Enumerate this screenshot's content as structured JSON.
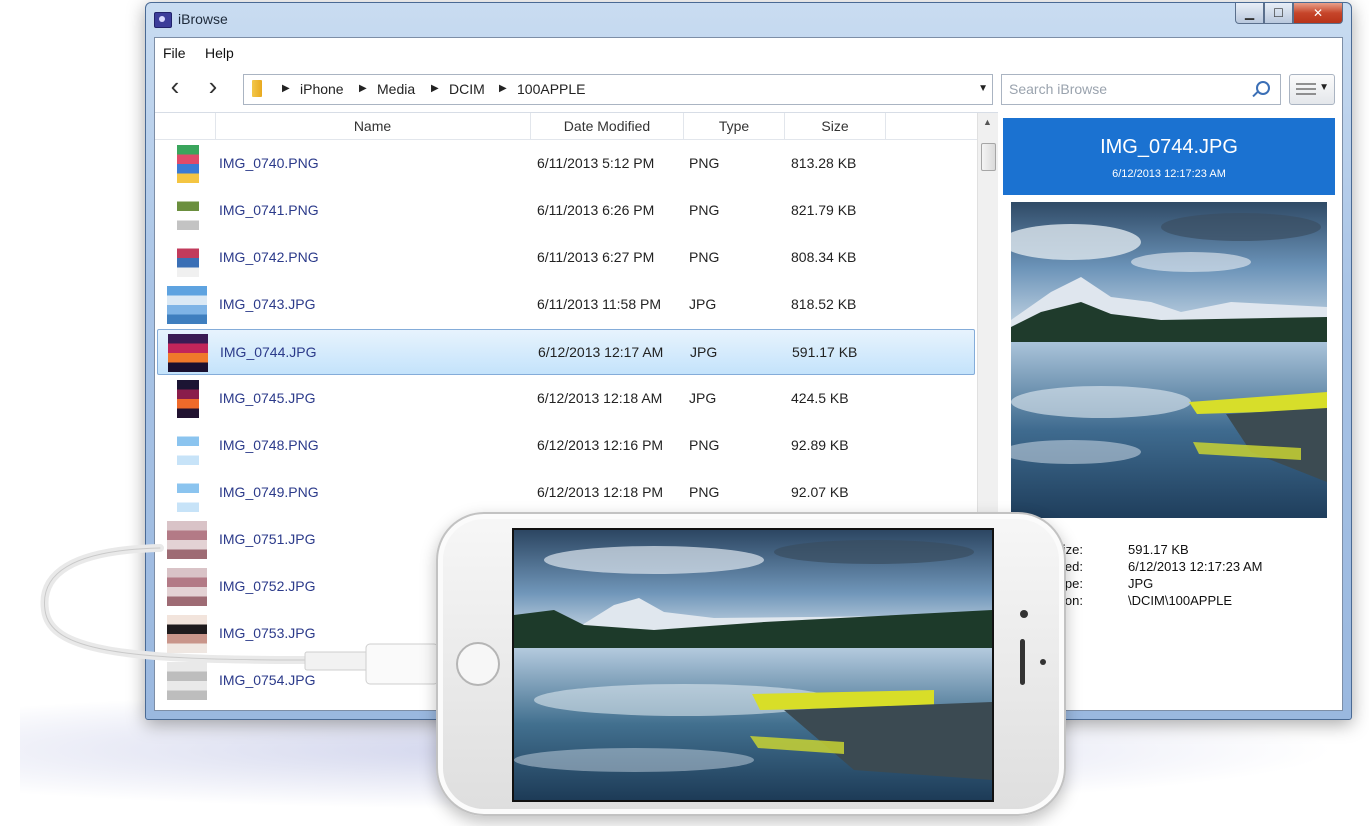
{
  "window": {
    "title": "iBrowse"
  },
  "menu": [
    "File",
    "Help"
  ],
  "breadcrumbs": [
    "iPhone",
    "Media",
    "DCIM",
    "100APPLE"
  ],
  "search": {
    "placeholder": "Search iBrowse"
  },
  "columns": {
    "name": "Name",
    "date": "Date Modified",
    "type": "Type",
    "size": "Size"
  },
  "files": [
    {
      "name": "IMG_0740.PNG",
      "date": "6/11/2013 5:12 PM",
      "type": "PNG",
      "size": "813.28 KB",
      "thumb": "screenshot-colorful"
    },
    {
      "name": "IMG_0741.PNG",
      "date": "6/11/2013 6:26 PM",
      "type": "PNG",
      "size": "821.79 KB",
      "thumb": "screenshot-green"
    },
    {
      "name": "IMG_0742.PNG",
      "date": "6/11/2013 6:27 PM",
      "type": "PNG",
      "size": "808.34 KB",
      "thumb": "screenshot-mixed"
    },
    {
      "name": "IMG_0743.JPG",
      "date": "6/11/2013 11:58 PM",
      "type": "JPG",
      "size": "818.52 KB",
      "thumb": "photo-sky"
    },
    {
      "name": "IMG_0744.JPG",
      "date": "6/12/2013 12:17 AM",
      "type": "JPG",
      "size": "591.17 KB",
      "thumb": "photo-sunset",
      "selected": true
    },
    {
      "name": "IMG_0745.JPG",
      "date": "6/12/2013 12:18 AM",
      "type": "JPG",
      "size": "424.5 KB",
      "thumb": "photo-sunset-portrait"
    },
    {
      "name": "IMG_0748.PNG",
      "date": "6/12/2013 12:16 PM",
      "type": "PNG",
      "size": "92.89 KB",
      "thumb": "screenshot-chat"
    },
    {
      "name": "IMG_0749.PNG",
      "date": "6/12/2013 12:18 PM",
      "type": "PNG",
      "size": "92.07 KB",
      "thumb": "screenshot-chat"
    },
    {
      "name": "IMG_0751.JPG",
      "date": "",
      "type": "",
      "size": "",
      "thumb": "photo-wall"
    },
    {
      "name": "IMG_0752.JPG",
      "date": "",
      "type": "",
      "size": "",
      "thumb": "photo-wall"
    },
    {
      "name": "IMG_0753.JPG",
      "date": "",
      "type": "",
      "size": "",
      "thumb": "photo-person"
    },
    {
      "name": "IMG_0754.JPG",
      "date": "",
      "type": "",
      "size": "",
      "thumb": "photo-partial"
    }
  ],
  "preview": {
    "name": "IMG_0744.JPG",
    "datetime": "6/12/2013 12:17:23 AM",
    "info": [
      {
        "label": "Size:",
        "value": "591.17 KB"
      },
      {
        "label": "Modified:",
        "value": "6/12/2013 12:17:23 AM"
      },
      {
        "label": "Type:",
        "value": "JPG"
      },
      {
        "label": "Location:",
        "value": "\\DCIM\\100APPLE"
      }
    ]
  },
  "colors": {
    "selection": "#c4e3fb",
    "preview_header": "#1b72d1",
    "link_text": "#2b3a8a"
  }
}
